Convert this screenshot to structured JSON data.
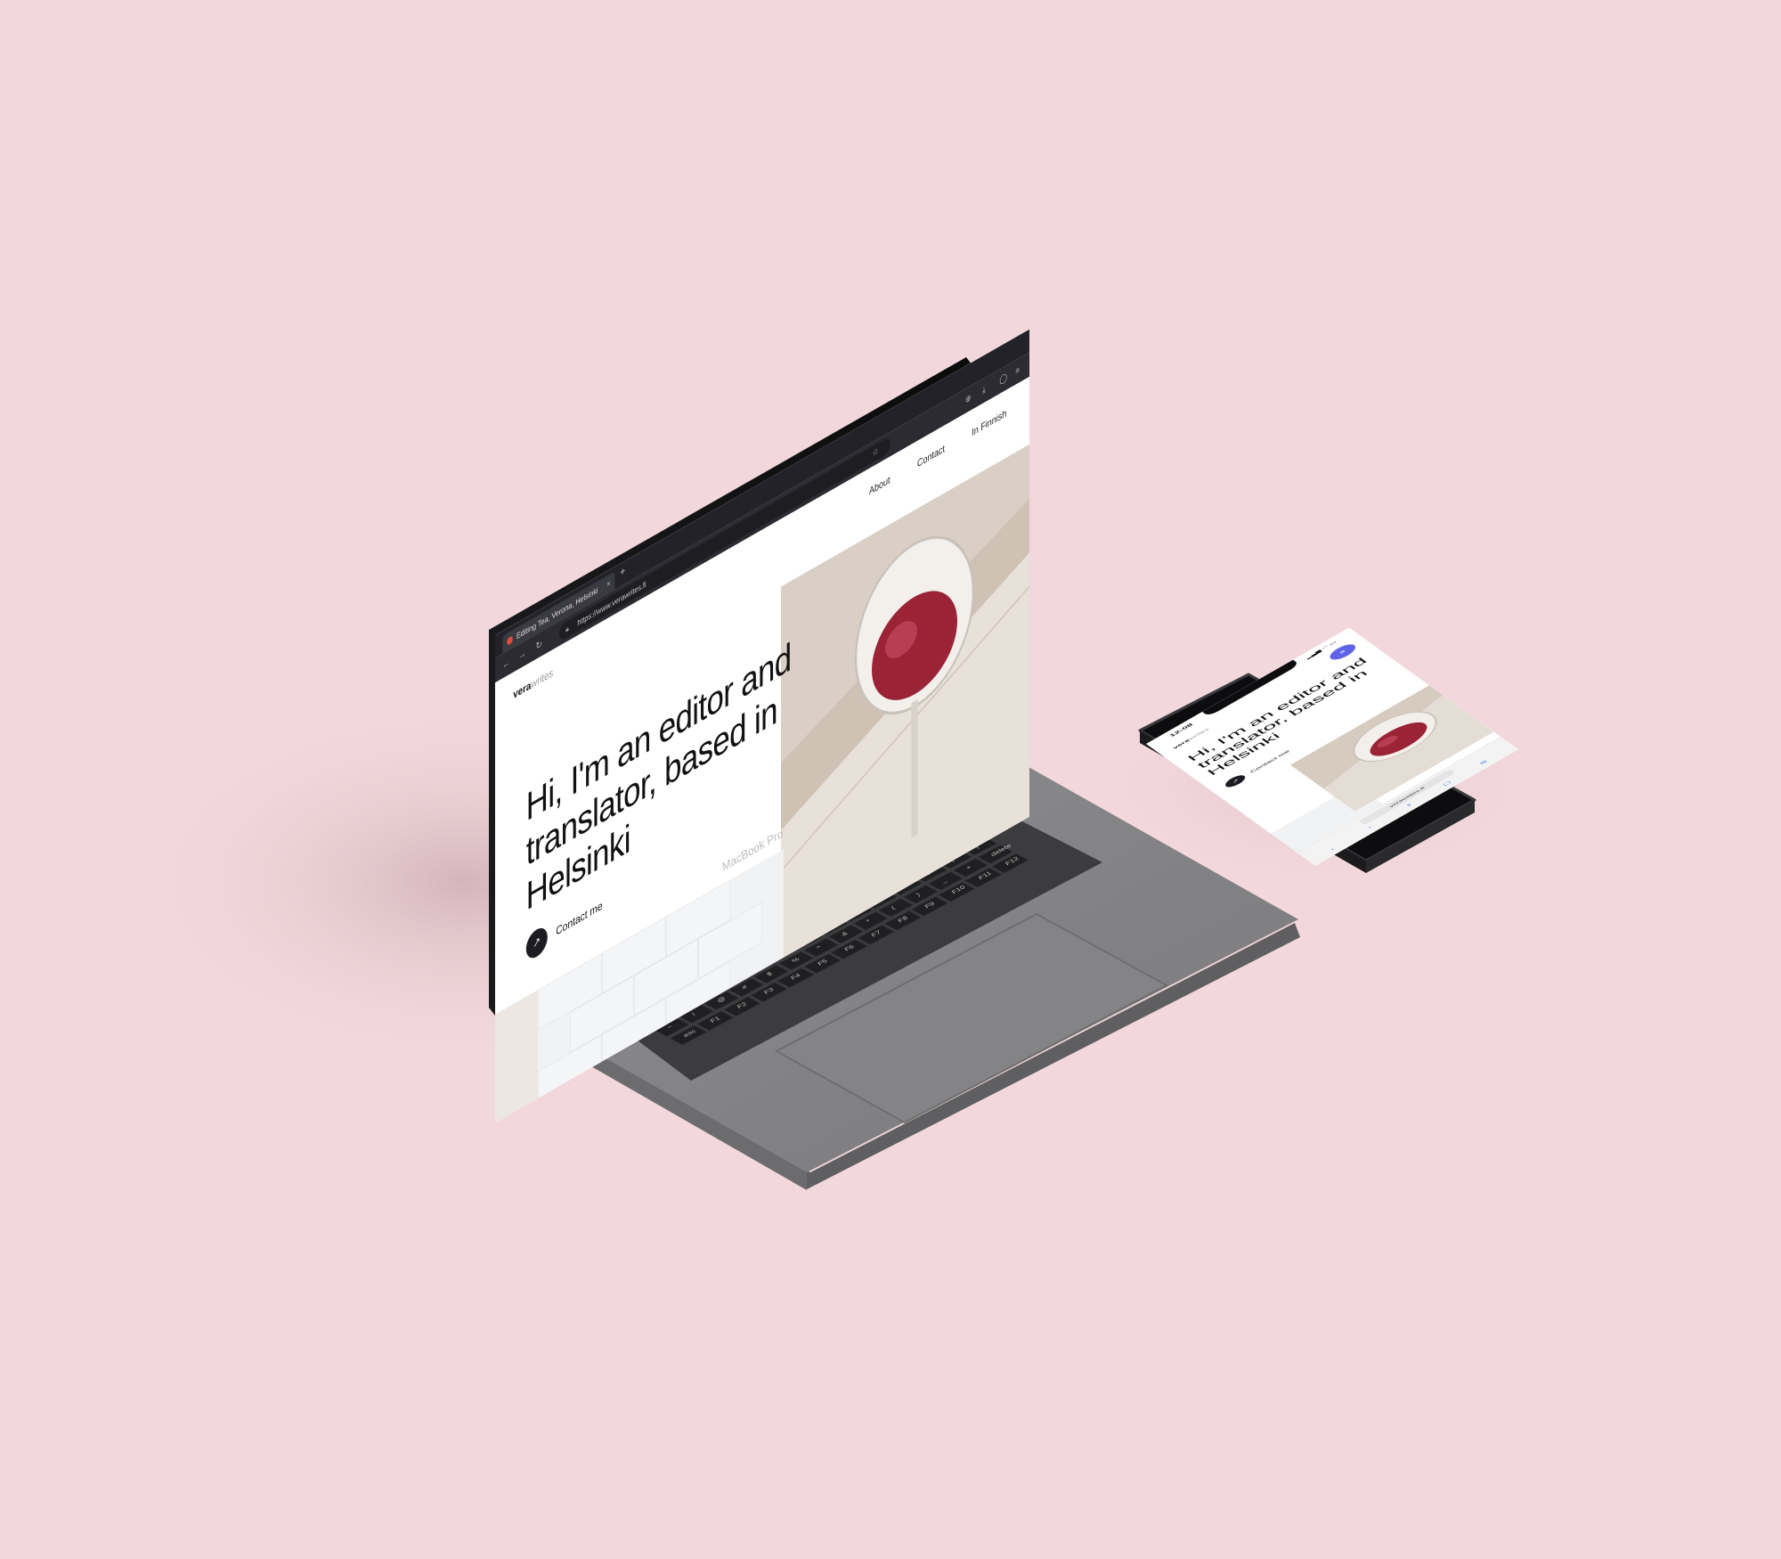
{
  "background_color": "#f2d8dc",
  "laptop": {
    "model_label": "MacBook Pro",
    "browser": {
      "tab_title": "Editing Tea, Verona, Helsinki",
      "tab_close": "×",
      "new_tab": "+",
      "url": "https://www.verawrites.fi",
      "icons": [
        "back-icon",
        "forward-icon",
        "reload-icon",
        "lock-icon",
        "star-icon",
        "download-icon",
        "menu-icon"
      ]
    },
    "site": {
      "brand_primary": "vera",
      "brand_secondary": "writes",
      "nav": [
        "About",
        "Contact",
        "In Finnish"
      ],
      "hero": "Hi, I'm an editor and translator, based in Helsinki",
      "cta_icon": "↗",
      "cta_label": "Contact me"
    },
    "keyboard": {
      "function_row": [
        "esc",
        "F1",
        "F2",
        "F3",
        "F4",
        "F5",
        "F6",
        "F7",
        "F8",
        "F9",
        "F10",
        "F11",
        "F12"
      ],
      "row1": [
        "~",
        "!",
        "@",
        "#",
        "$",
        "%",
        "^",
        "&",
        "*",
        "(",
        ")",
        "_",
        "+",
        "delete"
      ],
      "row2": [
        "tab",
        "Q",
        "W",
        "E",
        "R",
        "T",
        "Y",
        "U",
        "I",
        "O",
        "P",
        "{",
        "}",
        "|"
      ],
      "row3": [
        "caps lock",
        "A",
        "S",
        "D",
        "F",
        "G",
        "H",
        "J",
        "K",
        "L",
        ":",
        "\"",
        "return"
      ],
      "row4": [
        "shift",
        "Z",
        "X",
        "C",
        "V",
        "B",
        "N",
        "M",
        "<",
        ">",
        "?",
        "shift"
      ],
      "row5": [
        "fn",
        "control",
        "option",
        "command",
        "",
        "command",
        "option",
        "◀",
        "▲▼",
        "▶"
      ]
    }
  },
  "phone": {
    "time": "12:08",
    "status_icons": "▂▄▆ ◠ ▭",
    "site": {
      "brand_primary": "vera",
      "brand_secondary": "writes",
      "menu_icon": "≡",
      "hero": "Hi, I'm an editor and translator, based in Helsinki",
      "cta_icon": "↗",
      "cta_label": "Contact me"
    },
    "browser": {
      "url": "verawrites.fi",
      "toolbar": [
        "‹",
        "›",
        "⇪",
        "▢",
        "⧉"
      ]
    }
  }
}
